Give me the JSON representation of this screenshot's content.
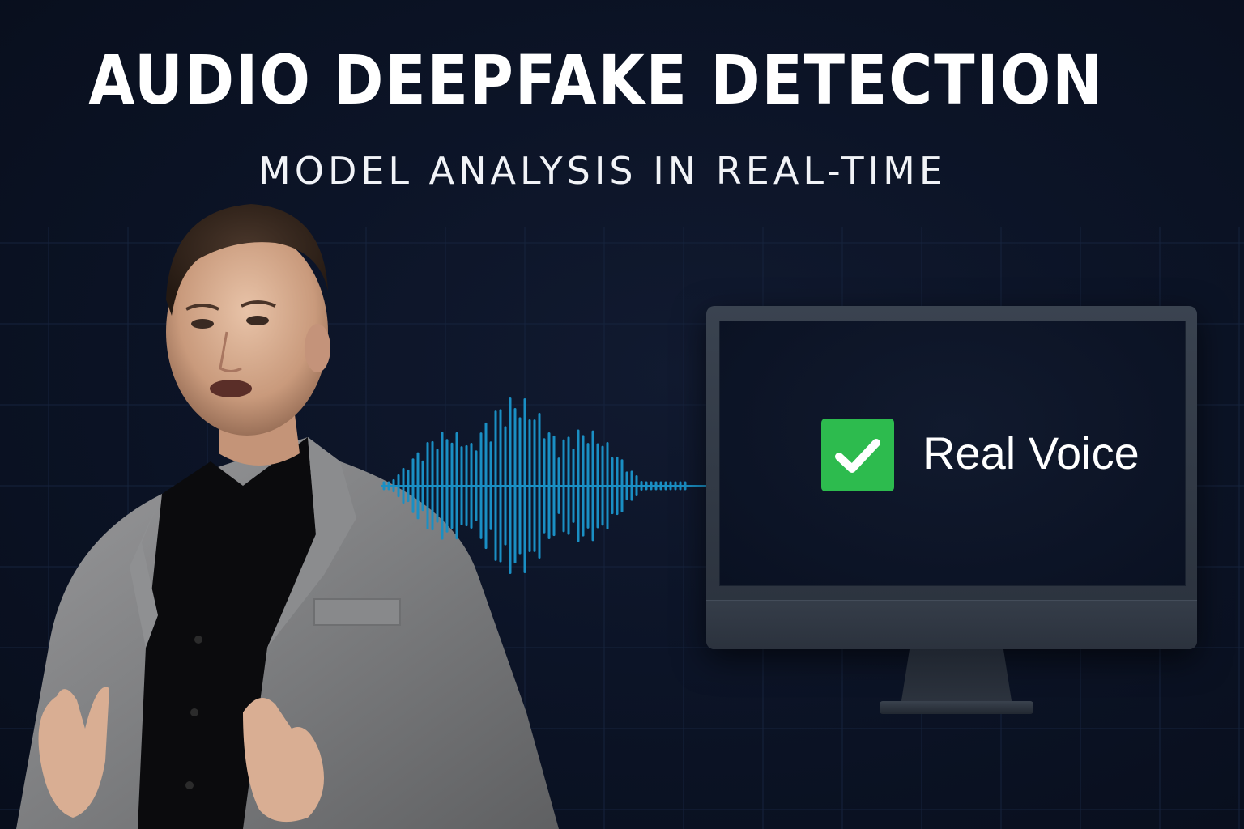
{
  "title": "AUDIO DEEPFAKE DETECTION",
  "subtitle": "MODEL ANALYSIS IN REAL-TIME",
  "result": {
    "label": "Real Voice",
    "status_icon": "check-icon",
    "status_color": "#2dbb4e"
  },
  "colors": {
    "background": "#0b1224",
    "waveform": "#1a8fc4",
    "grid": "#16233d"
  }
}
